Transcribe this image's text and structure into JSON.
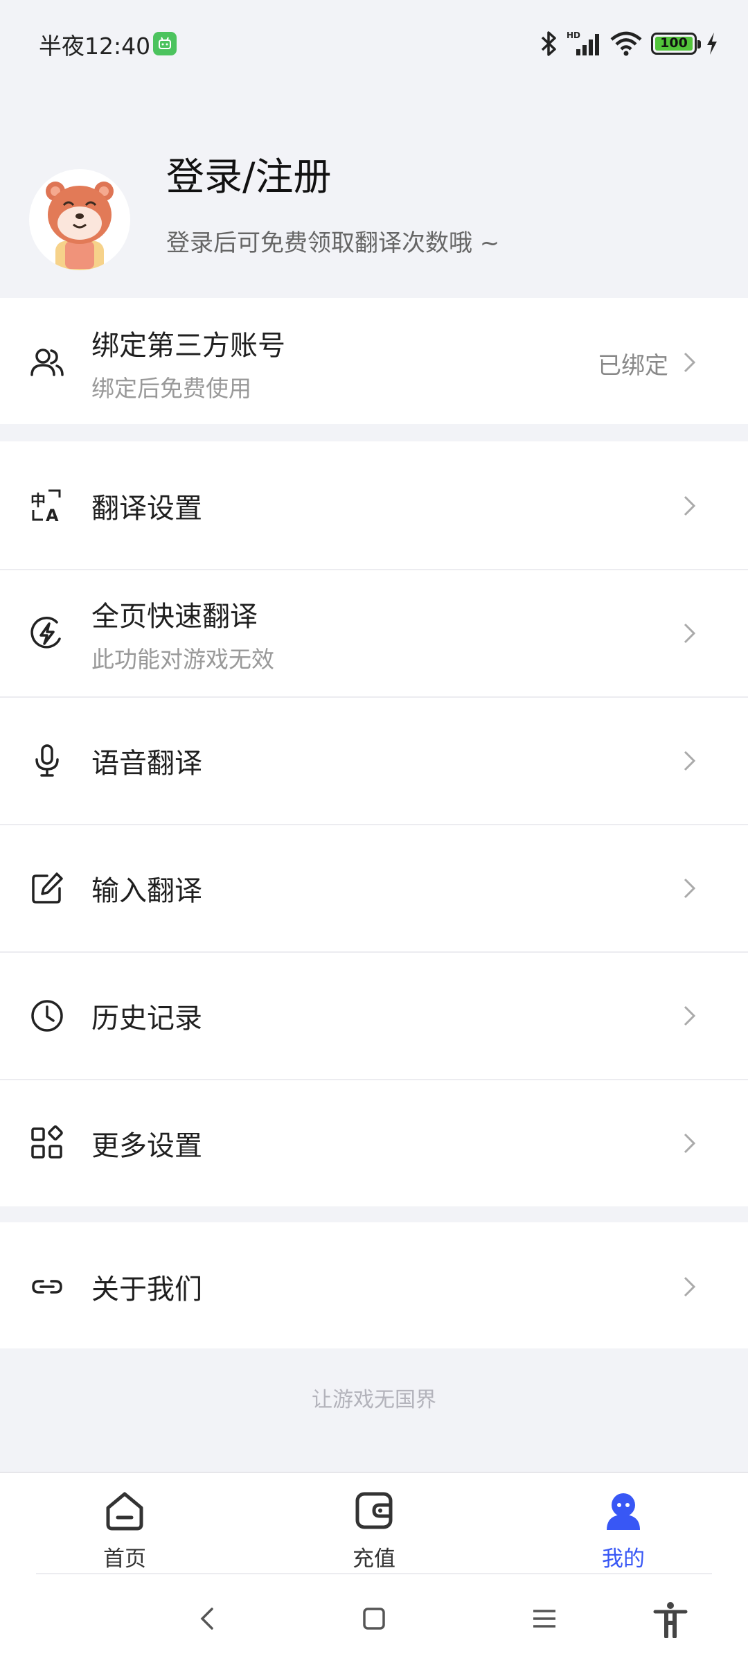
{
  "status_bar": {
    "time": "半夜12:40",
    "battery": "100",
    "icons": [
      "bluetooth-icon",
      "hd-signal-icon",
      "wifi-icon",
      "battery-icon",
      "charging-icon"
    ]
  },
  "profile": {
    "title": "登录/注册",
    "subtitle": "登录后可免费领取翻译次数哦 ~"
  },
  "bind_account": {
    "title": "绑定第三方账号",
    "subtitle": "绑定后免费使用",
    "status": "已绑定"
  },
  "menu": {
    "translate_settings": "翻译设置",
    "full_page": {
      "title": "全页快速翻译",
      "subtitle": "此功能对游戏无效"
    },
    "voice": "语音翻译",
    "input": "输入翻译",
    "history": "历史记录",
    "more": "更多设置",
    "about": "关于我们"
  },
  "footer": "让游戏无国界",
  "bottom_nav": {
    "home": "首页",
    "recharge": "充值",
    "mine": "我的",
    "active_color": "#3857f5"
  }
}
